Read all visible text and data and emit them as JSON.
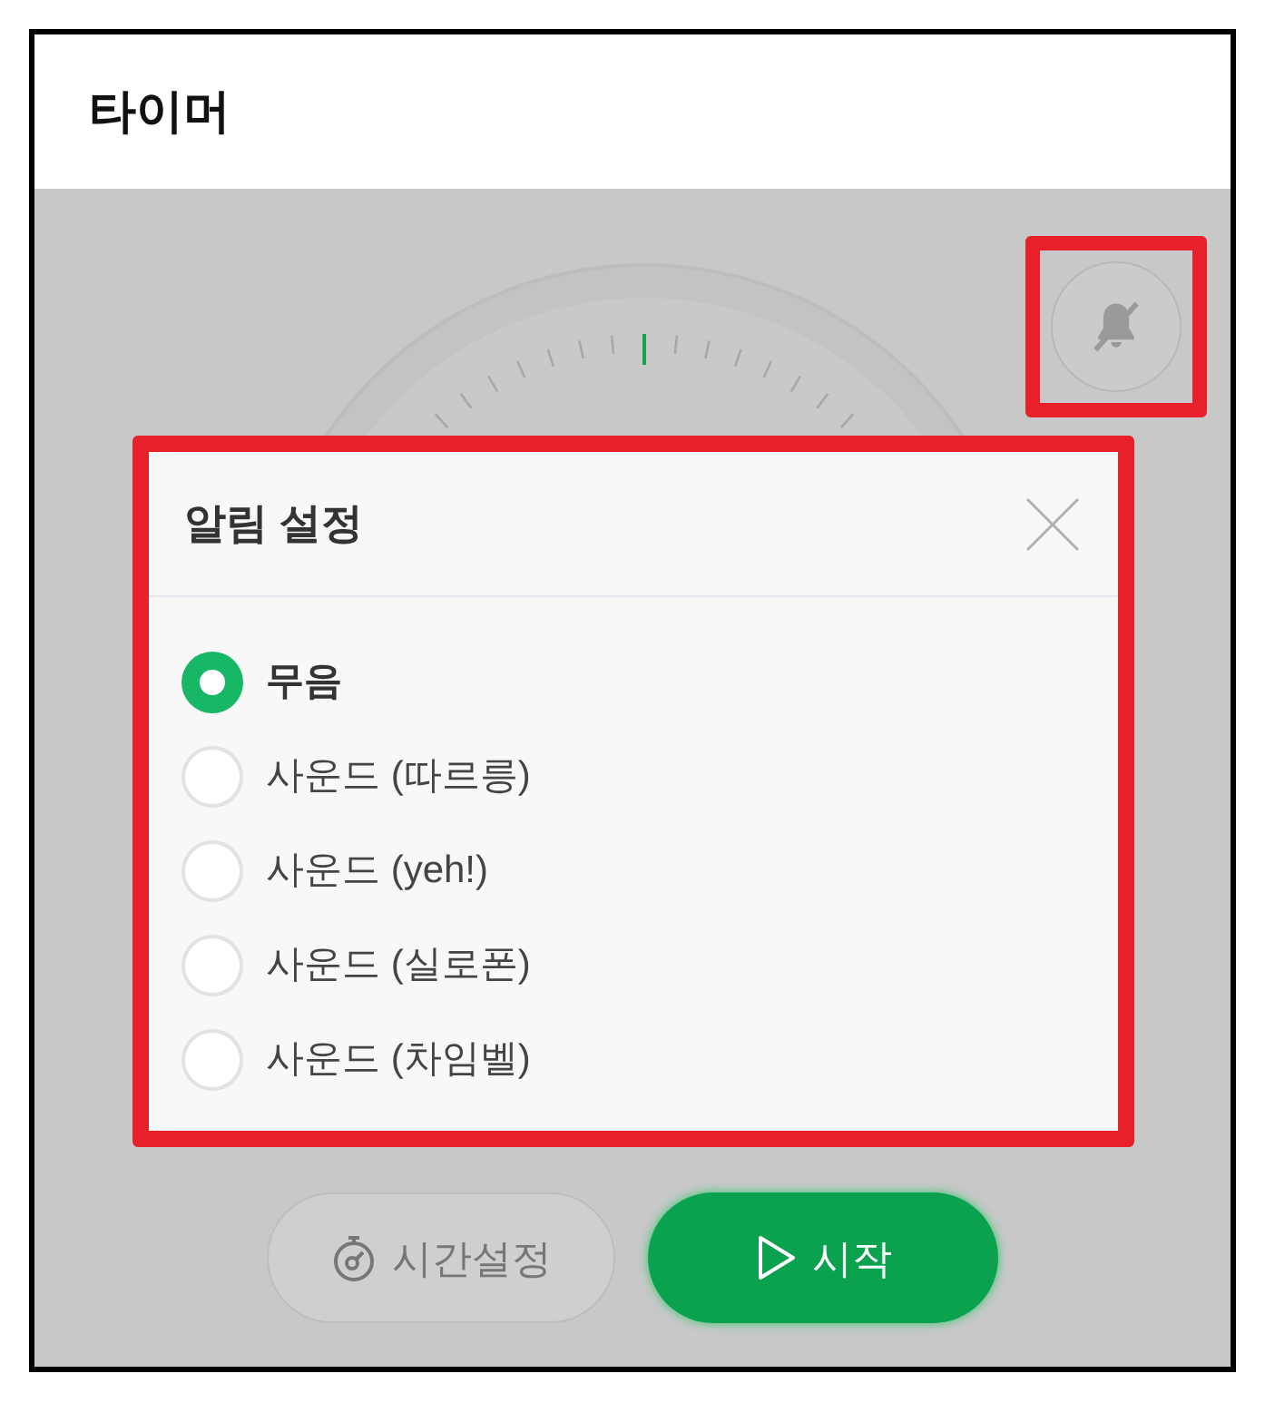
{
  "window": {
    "title": "타이머"
  },
  "dialog": {
    "title": "알림 설정",
    "options": [
      {
        "label": "무음",
        "selected": true
      },
      {
        "label": "사운드 (따르릉)",
        "selected": false
      },
      {
        "label": "사운드 (yeh!)",
        "selected": false
      },
      {
        "label": "사운드 (실로폰)",
        "selected": false
      },
      {
        "label": "사운드 (차임벨)",
        "selected": false
      }
    ]
  },
  "buttons": [
    {
      "kind": "secondary",
      "label": "시간설정"
    },
    {
      "kind": "primary",
      "label": "시작"
    }
  ]
}
